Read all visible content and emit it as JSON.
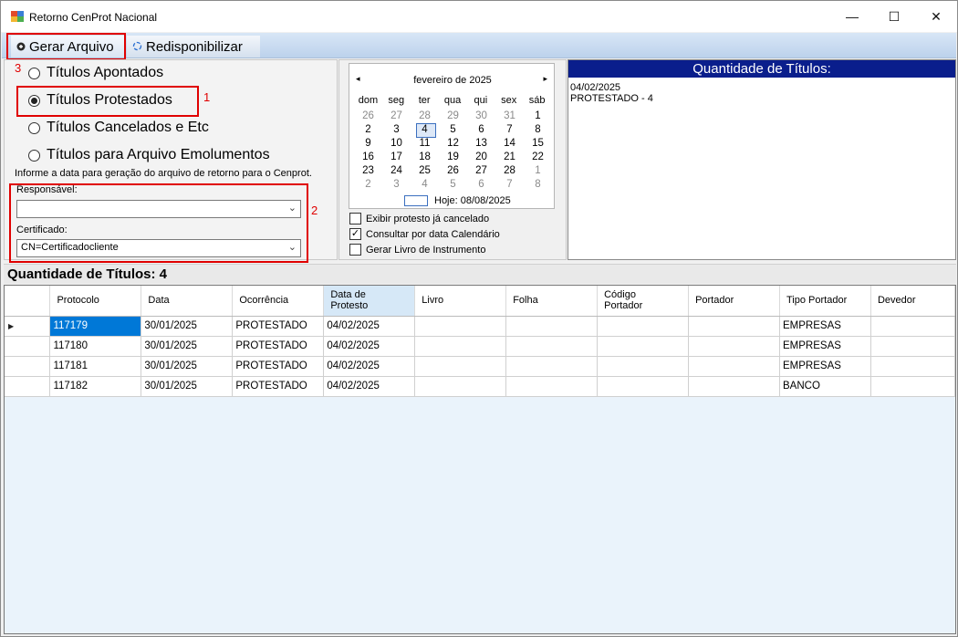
{
  "window": {
    "title": "Retorno CenProt Nacional",
    "min_glyph": "—",
    "max_glyph": "☐",
    "close_glyph": "✕"
  },
  "toolbar": {
    "gerar_label": "Gerar Arquivo",
    "redisp_label": "Redisponibilizar"
  },
  "annotations": {
    "n1": "1",
    "n2": "2",
    "n3": "3"
  },
  "options": {
    "items": [
      {
        "label": "Títulos Apontados",
        "checked": false
      },
      {
        "label": "Títulos Protestados",
        "checked": true
      },
      {
        "label": "Títulos Cancelados e Etc",
        "checked": false
      },
      {
        "label": "Títulos para Arquivo Emolumentos",
        "checked": false
      }
    ],
    "info": "Informe a data para geração do arquivo de retorno para o Cenprot."
  },
  "fields": {
    "responsavel_label": "Responsável:",
    "responsavel_value": "",
    "certificado_label": "Certificado:",
    "certificado_value": "CN=Certificadocliente"
  },
  "calendar": {
    "month": "fevereiro de 2025",
    "prev": "◂",
    "next": "▸",
    "weekdays": [
      "dom",
      "seg",
      "ter",
      "qua",
      "qui",
      "sex",
      "sáb"
    ],
    "weeks": [
      [
        "26",
        "27",
        "28",
        "29",
        "30",
        "31",
        "1"
      ],
      [
        "2",
        "3",
        "4",
        "5",
        "6",
        "7",
        "8"
      ],
      [
        "9",
        "10",
        "11",
        "12",
        "13",
        "14",
        "15"
      ],
      [
        "16",
        "17",
        "18",
        "19",
        "20",
        "21",
        "22"
      ],
      [
        "23",
        "24",
        "25",
        "26",
        "27",
        "28",
        "1"
      ],
      [
        "2",
        "3",
        "4",
        "5",
        "6",
        "7",
        "8"
      ]
    ],
    "selected": "4",
    "today": "Hoje: 08/08/2025"
  },
  "checks": [
    {
      "label": "Exibir protesto já cancelado",
      "checked": false
    },
    {
      "label": "Consultar por data Calendário",
      "checked": true
    },
    {
      "label": "Gerar Livro de Instrumento",
      "checked": false
    }
  ],
  "summary": {
    "title": "Quantidade de Títulos:",
    "lines": [
      "04/02/2025",
      "PROTESTADO - 4"
    ]
  },
  "grid": {
    "qtd_label": "Quantidade de Títulos: 4",
    "columns": [
      "Protocolo",
      "Data",
      "Ocorrência",
      "Data de Protesto",
      "Livro",
      "Folha",
      "Código Portador",
      "Portador",
      "Tipo Portador",
      "Devedor"
    ],
    "rows": [
      [
        "117179",
        "30/01/2025",
        "PROTESTADO",
        "04/02/2025",
        "",
        "",
        "",
        "",
        "EMPRESAS",
        ""
      ],
      [
        "117180",
        "30/01/2025",
        "PROTESTADO",
        "04/02/2025",
        "",
        "",
        "",
        "",
        "EMPRESAS",
        ""
      ],
      [
        "117181",
        "30/01/2025",
        "PROTESTADO",
        "04/02/2025",
        "",
        "",
        "",
        "",
        "EMPRESAS",
        ""
      ],
      [
        "117182",
        "30/01/2025",
        "PROTESTADO",
        "04/02/2025",
        "",
        "",
        "",
        "",
        "BANCO",
        ""
      ]
    ],
    "current_row_marker": "▶"
  }
}
